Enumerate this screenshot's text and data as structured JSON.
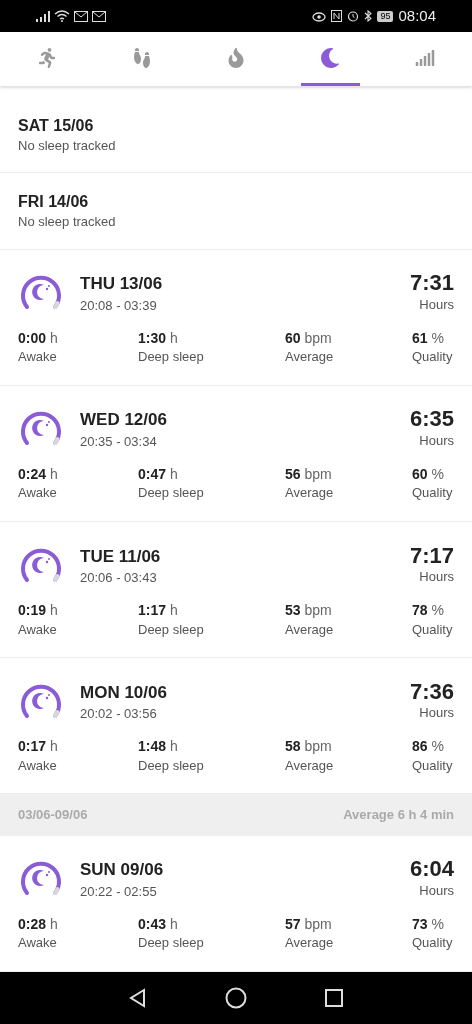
{
  "status_bar": {
    "battery": "95",
    "time": "08:04"
  },
  "tabs": [
    {
      "selected": false
    },
    {
      "selected": false
    },
    {
      "selected": false
    },
    {
      "selected": true
    },
    {
      "selected": false
    }
  ],
  "entries": [
    {
      "kind": "empty",
      "day": "SAT 15/06",
      "note": "No sleep tracked"
    },
    {
      "kind": "empty",
      "day": "FRI 14/06",
      "note": "No sleep tracked"
    },
    {
      "kind": "sleep",
      "day": "THU 13/06",
      "range": "20:08 - 03:39",
      "total": "7:31",
      "total_unit": "Hours",
      "stats": [
        {
          "value": "0:00",
          "unit": "h",
          "label": "Awake"
        },
        {
          "value": "1:30",
          "unit": "h",
          "label": "Deep sleep"
        },
        {
          "value": "60",
          "unit": "bpm",
          "label": "Average"
        },
        {
          "value": "61",
          "unit": "%",
          "label": "Quality"
        }
      ]
    },
    {
      "kind": "sleep",
      "day": "WED 12/06",
      "range": "20:35 - 03:34",
      "total": "6:35",
      "total_unit": "Hours",
      "stats": [
        {
          "value": "0:24",
          "unit": "h",
          "label": "Awake"
        },
        {
          "value": "0:47",
          "unit": "h",
          "label": "Deep sleep"
        },
        {
          "value": "56",
          "unit": "bpm",
          "label": "Average"
        },
        {
          "value": "60",
          "unit": "%",
          "label": "Quality"
        }
      ]
    },
    {
      "kind": "sleep",
      "day": "TUE 11/06",
      "range": "20:06 - 03:43",
      "total": "7:17",
      "total_unit": "Hours",
      "stats": [
        {
          "value": "0:19",
          "unit": "h",
          "label": "Awake"
        },
        {
          "value": "1:17",
          "unit": "h",
          "label": "Deep sleep"
        },
        {
          "value": "53",
          "unit": "bpm",
          "label": "Average"
        },
        {
          "value": "78",
          "unit": "%",
          "label": "Quality"
        }
      ]
    },
    {
      "kind": "sleep",
      "day": "MON 10/06",
      "range": "20:02 - 03:56",
      "total": "7:36",
      "total_unit": "Hours",
      "stats": [
        {
          "value": "0:17",
          "unit": "h",
          "label": "Awake"
        },
        {
          "value": "1:48",
          "unit": "h",
          "label": "Deep sleep"
        },
        {
          "value": "58",
          "unit": "bpm",
          "label": "Average"
        },
        {
          "value": "86",
          "unit": "%",
          "label": "Quality"
        }
      ]
    },
    {
      "kind": "week",
      "range": "03/06-09/06",
      "average": "Average 6 h 4 min"
    },
    {
      "kind": "sleep",
      "day": "SUN 09/06",
      "range": "20:22 - 02:55",
      "total": "6:04",
      "total_unit": "Hours",
      "stats": [
        {
          "value": "0:28",
          "unit": "h",
          "label": "Awake"
        },
        {
          "value": "0:43",
          "unit": "h",
          "label": "Deep sleep"
        },
        {
          "value": "57",
          "unit": "bpm",
          "label": "Average"
        },
        {
          "value": "73",
          "unit": "%",
          "label": "Quality"
        }
      ]
    }
  ]
}
